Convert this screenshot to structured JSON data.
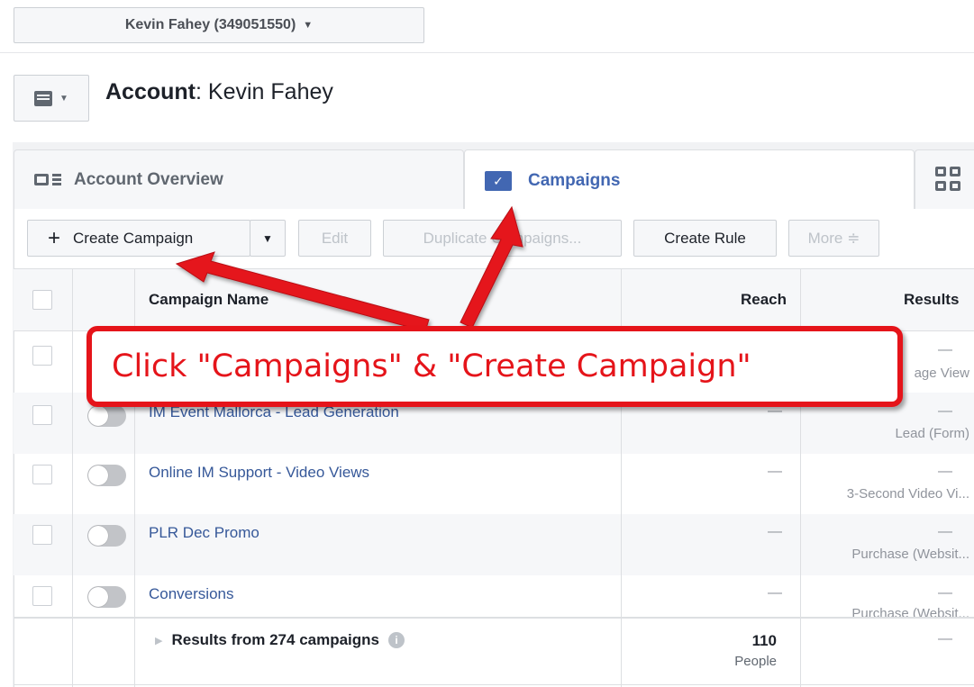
{
  "account_selector": {
    "label": "Kevin Fahey (349051550)",
    "icon": "caret-down-icon"
  },
  "header": {
    "title_label": "Account",
    "title_separator": ": ",
    "title_value": "Kevin Fahey"
  },
  "tabs": [
    {
      "label": "Account Overview",
      "icon": "overview-icon",
      "active": false
    },
    {
      "label": "Campaigns",
      "icon": "folder-check-icon",
      "active": true
    },
    {
      "label": "",
      "icon": "grid-icon",
      "active": false
    }
  ],
  "toolbar": {
    "create_label": "Create Campaign",
    "edit_label": "Edit",
    "duplicate_label": "Duplicate Campaigns...",
    "rule_label": "Create Rule",
    "more_label": "More ≑"
  },
  "table": {
    "columns": {
      "name": "Campaign Name",
      "reach": "Reach",
      "results": "Results"
    },
    "rows": [
      {
        "name": "",
        "reach": "—",
        "result_value": "—",
        "result_label": "age View"
      },
      {
        "name": "IM Event Mallorca - Lead Generation",
        "reach": "—",
        "result_value": "—",
        "result_label": "Lead (Form)"
      },
      {
        "name": "Online IM Support - Video Views",
        "reach": "—",
        "result_value": "—",
        "result_label": "3-Second Video Vi..."
      },
      {
        "name": "PLR Dec Promo",
        "reach": "—",
        "result_value": "—",
        "result_label": "Purchase (Websit..."
      },
      {
        "name": "Conversions",
        "reach": "—",
        "result_value": "—",
        "result_label": "Purchase (Websit..."
      }
    ],
    "footer": {
      "label": "Results from 274 campaigns",
      "reach_value": "110",
      "reach_unit": "People",
      "results_value": "—"
    }
  },
  "annotation": {
    "text": "Click \"Campaigns\" & \"Create Campaign\"",
    "color": "#e5141a"
  },
  "colors": {
    "link": "#365899",
    "accent": "#4267b2",
    "annotation_red": "#e5141a"
  }
}
